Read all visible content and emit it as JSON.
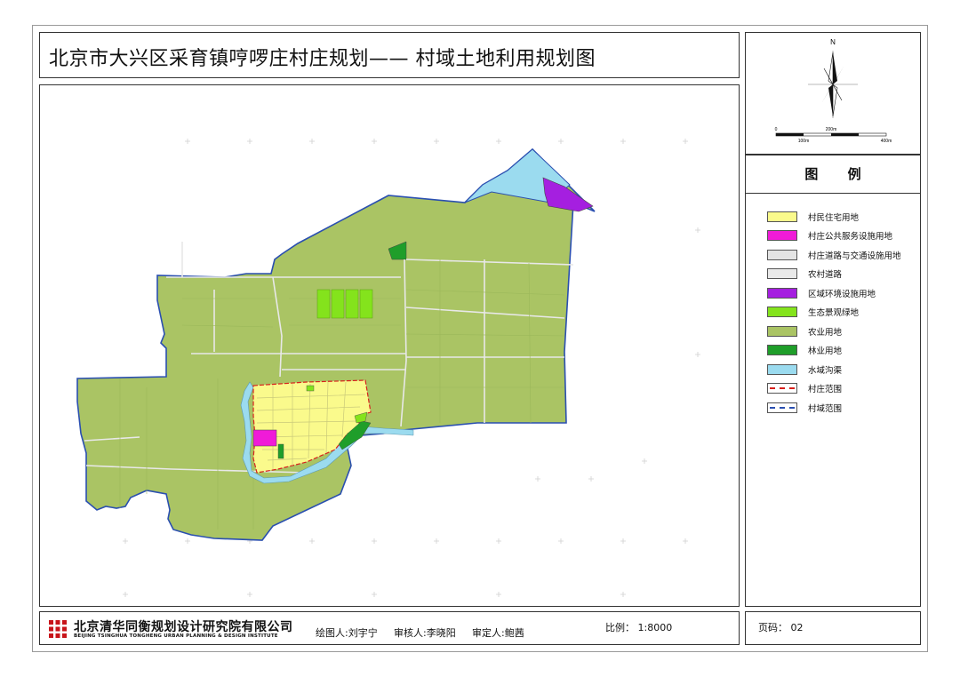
{
  "title": "北京市大兴区采育镇哼啰庄村庄规划—— 村域土地利用规划图",
  "compass": {
    "north": "N",
    "scale_labels": [
      "0",
      "200m",
      "100m",
      "400m"
    ]
  },
  "legend": {
    "title": "图 例",
    "items": [
      {
        "label": "村民住宅用地",
        "color": "#fafa8c",
        "kind": "fill"
      },
      {
        "label": "村庄公共服务设施用地",
        "color": "#f01bd8",
        "kind": "fill"
      },
      {
        "label": "村庄道路与交通设施用地",
        "color": "#e4e4e4",
        "kind": "fill"
      },
      {
        "label": "农村道路",
        "color": "#e9e9e9",
        "kind": "fill"
      },
      {
        "label": "区域环境设施用地",
        "color": "#a51fe0",
        "kind": "fill"
      },
      {
        "label": "生态景观绿地",
        "color": "#84e31c",
        "kind": "fill"
      },
      {
        "label": "农业用地",
        "color": "#aac464",
        "kind": "fill"
      },
      {
        "label": "林业用地",
        "color": "#1f9e2a",
        "kind": "fill"
      },
      {
        "label": "水域沟渠",
        "color": "#9bdbef",
        "kind": "fill"
      },
      {
        "label": "村庄范围",
        "color": "#d8201c",
        "kind": "line"
      },
      {
        "label": "村域范围",
        "color": "#2a4fb0",
        "kind": "line"
      }
    ]
  },
  "footer": {
    "org_cn": "北京清华同衡规划设计研究院有限公司",
    "org_en": "BEIJING TSINGHUA TONGHENG URBAN PLANNING & DESIGN INSTITUTE",
    "drawn_by": "绘图人:刘宇宁",
    "checked_by": "审核人:李晓阳",
    "approved_by": "审定人:鲍茜",
    "scale": "比例： 1:8000",
    "page": "页码： 02"
  },
  "colors": {
    "agriculture": "#aac464",
    "water": "#9bdbef",
    "residential": "#fafa8c",
    "public_service": "#f01bd8",
    "environmental": "#a51fe0",
    "ecological_green": "#84e31c",
    "forestry": "#1f9e2a",
    "boundary": "#2a4fb0",
    "village_boundary": "#d8201c"
  }
}
